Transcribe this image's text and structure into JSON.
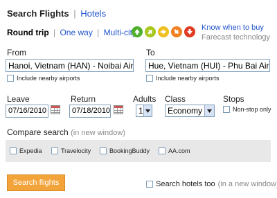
{
  "header": {
    "tab_active": "Search  Flights",
    "tab_sep": "|",
    "tab_hotels": "Hotels"
  },
  "trip_modes": {
    "round_trip": "Round trip",
    "sep": "|",
    "one_way": "One way",
    "multi_city": "Multi-city"
  },
  "farecast": {
    "arrow_icons": [
      {
        "name": "green-up-arrow-icon",
        "color": "#4caf28"
      },
      {
        "name": "yellow-green-up-right-arrow-icon",
        "color": "#a8c81e"
      },
      {
        "name": "yellow-right-arrow-icon",
        "color": "#f0c020"
      },
      {
        "name": "orange-down-right-arrow-icon",
        "color": "#f08020"
      },
      {
        "name": "red-down-arrow-icon",
        "color": "#e03a20"
      }
    ],
    "link": "Know when to buy",
    "caption": "Farecast technology"
  },
  "from": {
    "label": "From",
    "value": "Hanoi, Vietnam (HAN) - Noibai Airport",
    "nearby": "Include nearby airports"
  },
  "to": {
    "label": "To",
    "value": "Hue, Vietnam (HUI) - Phu Bai Airport",
    "nearby": "Include nearby airports"
  },
  "leave": {
    "label": "Leave",
    "value": "07/16/2010"
  },
  "return": {
    "label": "Return",
    "value": "07/18/2010"
  },
  "adults": {
    "label": "Adults",
    "value": "1"
  },
  "class": {
    "label": "Class",
    "value": "Economy"
  },
  "stops": {
    "label": "Stops",
    "nonstop": "Non-stop only"
  },
  "compare": {
    "title": "Compare search",
    "note": "(in new window)",
    "sites": [
      "Expedia",
      "Travelocity",
      "BookingBuddy",
      "AA.com"
    ]
  },
  "actions": {
    "search": "Search flights",
    "hotels_too": "Search hotels too",
    "hotels_note": "(in a new window)"
  },
  "colors": {
    "accent": "#f2a33a",
    "link": "#2255cc"
  }
}
